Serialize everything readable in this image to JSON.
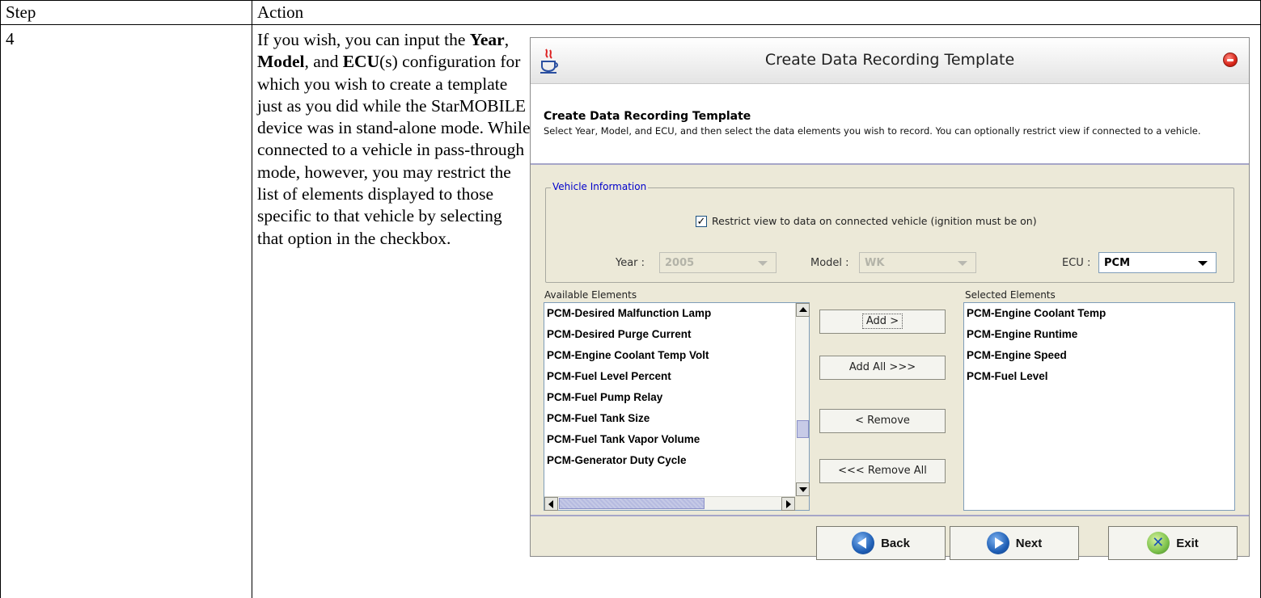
{
  "doc": {
    "header_step": "Step",
    "header_action": "Action",
    "step_number": "4",
    "instruction": {
      "p1": "If you wish, you can input the ",
      "year": "Year",
      "sep1": ", ",
      "model": "Model",
      "sep2": ", and ",
      "ecu": "ECU",
      "p2": "(s) configuration for which you wish to create a template just as you did while the StarMOBILE device was in stand-alone mode.  While connected to a vehicle in pass-through mode, however, you may restrict the list of elements displayed to those specific to that vehicle by selecting that option in the checkbox."
    }
  },
  "dialog": {
    "title": "Create Data Recording Template",
    "header_title": "Create Data Recording Template",
    "header_desc": "Select Year, Model, and ECU, and then select the data elements you wish to record.  You can optionally restrict view if connected to a vehicle.",
    "group_title": "Vehicle Information",
    "restrict_label": "Restrict view to data on connected vehicle (ignition must be on)",
    "restrict_checked": true,
    "year_label": "Year :",
    "year_value": "2005",
    "model_label": "Model :",
    "model_value": "WK",
    "ecu_label": "ECU :",
    "ecu_value": "PCM",
    "available_label": "Available Elements",
    "selected_label": "Selected Elements",
    "available": [
      "PCM-Desired Malfunction Lamp",
      "PCM-Desired Purge Current",
      "PCM-Engine Coolant Temp Volt",
      "PCM-Fuel Level Percent",
      "PCM-Fuel Pump Relay",
      "PCM-Fuel Tank Size",
      "PCM-Fuel Tank Vapor Volume",
      "PCM-Generator Duty Cycle"
    ],
    "selected": [
      "PCM-Engine Coolant Temp",
      "PCM-Engine Runtime",
      "PCM-Engine Speed",
      "PCM-Fuel Level"
    ],
    "buttons": {
      "add": "Add >",
      "add_all": "Add All >>>",
      "remove": "< Remove",
      "remove_all": "<<< Remove All",
      "back": "Back",
      "next": "Next",
      "exit": "Exit"
    },
    "icons": {
      "app": "java-cup-icon",
      "close": "close-icon",
      "back": "back-arrow-icon",
      "next": "next-arrow-icon",
      "exit": "exit-x-icon"
    }
  }
}
